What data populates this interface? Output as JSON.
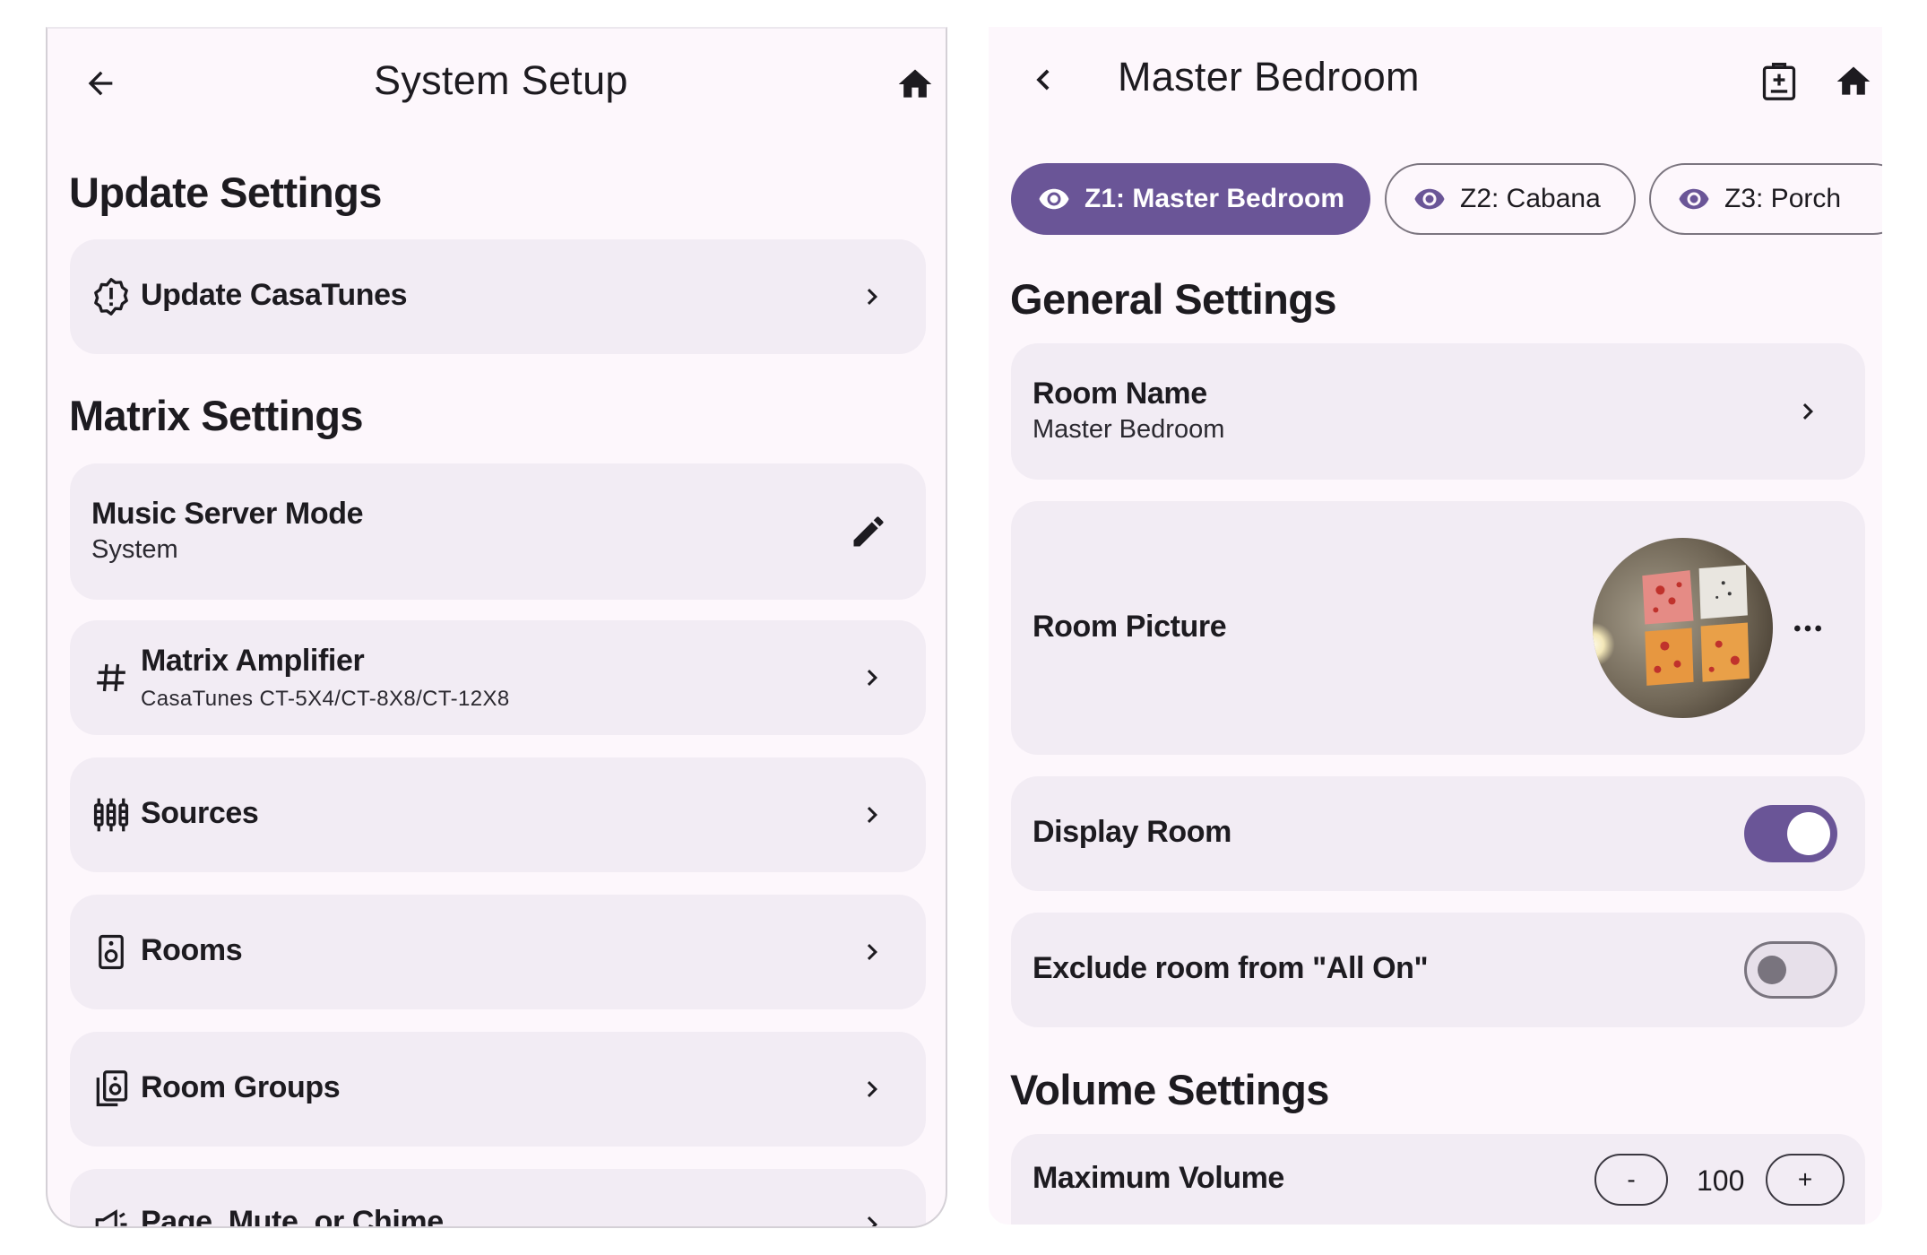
{
  "left": {
    "title": "System Setup",
    "sections": {
      "update": "Update Settings",
      "matrix": "Matrix Settings"
    },
    "items": {
      "update_casatunes": {
        "title": "Update CasaTunes"
      },
      "music_server_mode": {
        "title": "Music Server Mode",
        "subtitle": "System"
      },
      "matrix_amplifier": {
        "title": "Matrix Amplifier",
        "subtitle": "CasaTunes CT-5X4/CT-8X8/CT-12X8"
      },
      "sources": {
        "title": "Sources"
      },
      "rooms": {
        "title": "Rooms"
      },
      "room_groups": {
        "title": "Room Groups"
      },
      "page_mute_chime": {
        "title": "Page, Mute, or Chime"
      }
    }
  },
  "right": {
    "title": "Master Bedroom",
    "chips": [
      {
        "label": "Z1: Master Bedroom",
        "selected": true
      },
      {
        "label": "Z2: Cabana",
        "selected": false
      },
      {
        "label": "Z3: Porch",
        "selected": false
      }
    ],
    "sections": {
      "general": "General Settings",
      "volume": "Volume Settings"
    },
    "room_name": {
      "title": "Room Name",
      "value": "Master Bedroom"
    },
    "room_picture": {
      "title": "Room Picture"
    },
    "display_room": {
      "title": "Display Room",
      "on": true
    },
    "exclude_all_on": {
      "title": "Exclude room from \"All On\"",
      "on": false
    },
    "max_volume": {
      "title": "Maximum Volume",
      "value": "100",
      "minus": "-",
      "plus": "+"
    }
  },
  "colors": {
    "accent": "#6a5597",
    "surface": "#fdf7fc",
    "card": "#f2ecf4",
    "text": "#1d1b20"
  }
}
